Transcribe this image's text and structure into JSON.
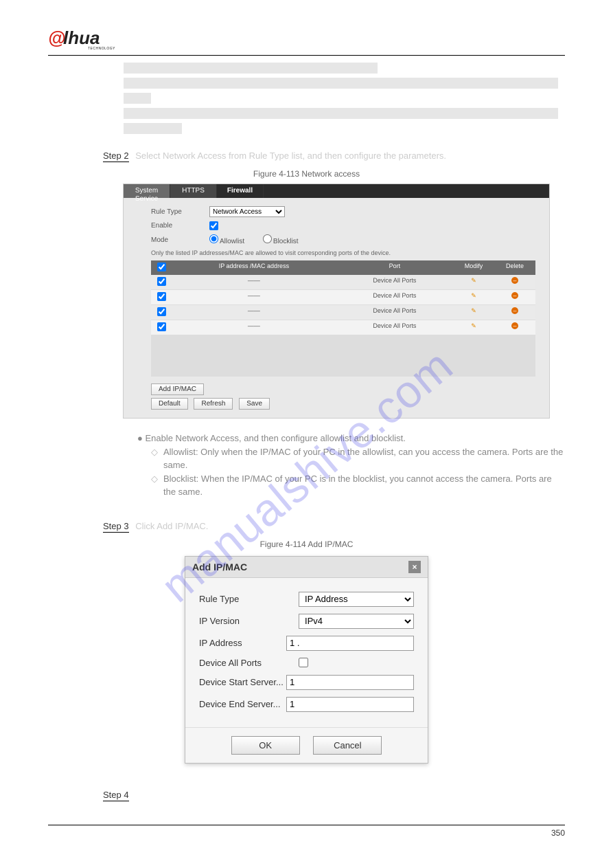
{
  "logo": {
    "brand": "alhua",
    "sub": "TECHNOLOGY"
  },
  "watermark": "manualshive.com",
  "steps": {
    "step2": {
      "label": "Step 2",
      "text_after": "Select Network Access from Rule Type list, and then configure the parameters."
    },
    "step3": {
      "label": "Step 3",
      "text_after": "Click Add IP/MAC."
    },
    "step4": {
      "label": "Step 4"
    }
  },
  "figures": {
    "fig1": "Figure 4-113 Network access",
    "fig2": "Figure 4-114 Add IP/MAC"
  },
  "firewall": {
    "tabs": {
      "system_service": "System Service",
      "https": "HTTPS",
      "firewall": "Firewall"
    },
    "form": {
      "rule_type_label": "Rule Type",
      "rule_type_value": "Network Access",
      "enable_label": "Enable",
      "enable_checked": "true",
      "mode_label": "Mode",
      "mode_allow": "Allowlist",
      "mode_block": "Blocklist",
      "note": "Only the listed IP addresses/MAC are allowed to visit corresponding ports of the device."
    },
    "table": {
      "headers": {
        "check": "",
        "ip": "IP address /MAC address",
        "port": "Port",
        "modify": "Modify",
        "delete": "Delete"
      },
      "rows": [
        {
          "ip": "——",
          "port": "Device All Ports"
        },
        {
          "ip": "——",
          "port": "Device All Ports"
        },
        {
          "ip": "——",
          "port": "Device All Ports"
        },
        {
          "ip": "——",
          "port": "Device All Ports"
        }
      ]
    },
    "buttons": {
      "add": "Add IP/MAC",
      "default": "Default",
      "refresh": "Refresh",
      "save": "Save"
    }
  },
  "desc": {
    "enable_line": "Enable Network Access, and then configure allowlist and blocklist.",
    "allowlist": "Allowlist: Only when the IP/MAC of your PC in the allowlist, can you access the camera. Ports are the same.",
    "blocklist": "Blocklist: When the IP/MAC of your PC is in the blocklist, you cannot access the camera. Ports are the same."
  },
  "dialog": {
    "title": "Add IP/MAC",
    "fields": {
      "rule_type": {
        "label": "Rule Type",
        "value": "IP Address"
      },
      "ip_version": {
        "label": "IP Version",
        "value": "IPv4"
      },
      "ip_address": {
        "label": "IP Address",
        "value": "1 ."
      },
      "all_ports": {
        "label": "Device All Ports"
      },
      "start_port": {
        "label": "Device Start Server...",
        "value": "1"
      },
      "end_port": {
        "label": "Device End Server...",
        "value": "1"
      }
    },
    "buttons": {
      "ok": "OK",
      "cancel": "Cancel"
    }
  },
  "page_number": "350"
}
